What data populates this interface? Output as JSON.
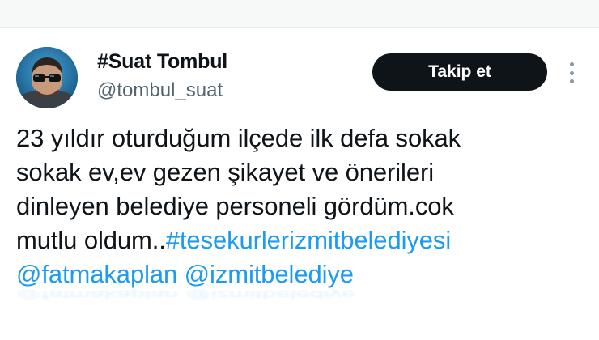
{
  "profile": {
    "display_name": "#Suat Tombul",
    "handle": "@tombul_suat",
    "follow_label": "Takip et"
  },
  "tweet": {
    "line1": "23 yıldır oturduğum ilçede ilk defa sokak",
    "line2": "sokak ev,ev gezen şikayet ve önerileri",
    "line3": "dinleyen belediye personeli gördüm.cok",
    "line4_text": "mutlu oldum..",
    "hashtag": "#tesekurlerizmitbelediyesi",
    "mention1": "@fatmakaplan",
    "mention2": "@izmitbelediye"
  },
  "colors": {
    "link": "#1d9bf0",
    "follow_button": "#0f1419",
    "handle": "#536471"
  },
  "icons": {
    "more": "more-vertical-icon"
  }
}
